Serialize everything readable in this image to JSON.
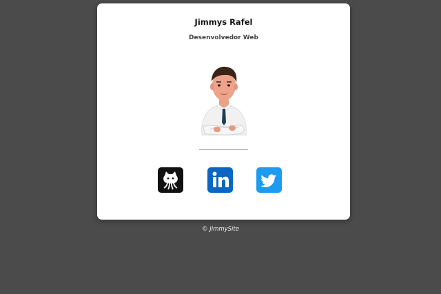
{
  "profile": {
    "name": "Jimmys Rafel",
    "role": "Desenvolvedor Web"
  },
  "social": [
    {
      "icon": "github-icon",
      "color": "#111111"
    },
    {
      "icon": "linkedin-icon",
      "color": "#0a66c2"
    },
    {
      "icon": "twitter-icon",
      "color": "#1d9bf0"
    }
  ],
  "footer": {
    "text": "© JimmySite"
  }
}
